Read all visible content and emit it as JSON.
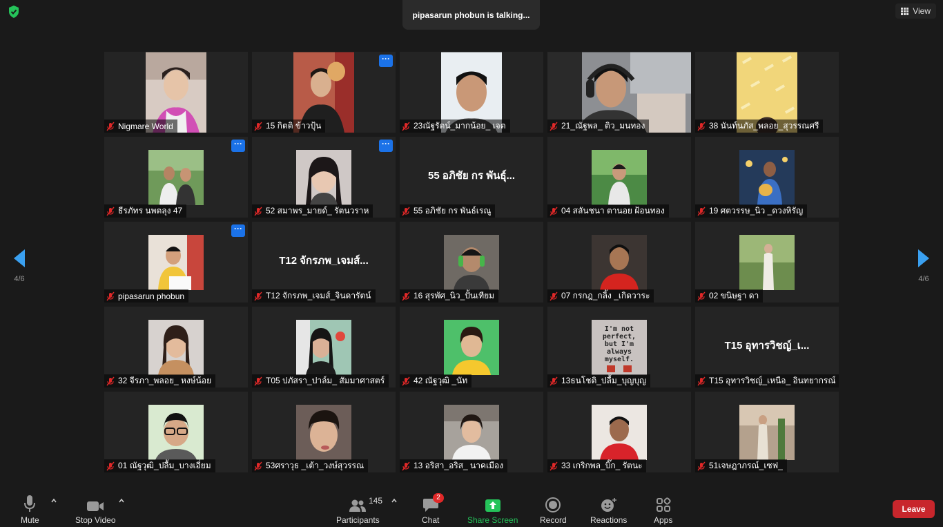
{
  "header": {
    "talking_banner": "pipasarun phobun is talking...",
    "view_label": "View"
  },
  "pager": {
    "left": "4/6",
    "right": "4/6"
  },
  "participants": [
    {
      "name": "Nigmare World",
      "video": true,
      "more_menu": false
    },
    {
      "name": "15 กิตติ ข้าวปุ้น",
      "video": true,
      "more_menu": true
    },
    {
      "name": "23ณัฐรัตน์_มากน้อย_ เจต",
      "video": true,
      "more_menu": false
    },
    {
      "name": "21_ณัฐพล_ ติว_มนทอง",
      "video": true,
      "more_menu": false
    },
    {
      "name": "38 นันท์นภัส_พลอย_สุวรรณศรี",
      "video": true,
      "more_menu": false
    },
    {
      "name": "ธีรภัทร นพตลุง 47",
      "video": true,
      "more_menu": true
    },
    {
      "name": "52 สมาพร_มายด์_ รัตนวราห",
      "video": true,
      "more_menu": true
    },
    {
      "name": "55 อภิชัย กร พันธ์เรณู",
      "big_label": "55 อภิชัย กร พันธุ์...",
      "video": false,
      "more_menu": false
    },
    {
      "name": "04 สลันชนา ตานอย ฝ้อนทอง",
      "video": true,
      "more_menu": false
    },
    {
      "name": "19 ศตวรรษ_นิว _ดวงหิรัญ",
      "video": true,
      "more_menu": false
    },
    {
      "name": "pipasarun phobun",
      "video": true,
      "more_menu": true
    },
    {
      "name": "T12 จักรภพ_เจมส์_จินดารัตน์",
      "big_label": "T12 จักรภพ_เจมส์...",
      "video": false,
      "more_menu": false
    },
    {
      "name": "16 สุรพัศ_นิว_ปั้นเทียม",
      "video": true,
      "more_menu": false
    },
    {
      "name": "07 กรกฎ_กลิ้ง _เกิดวาระ",
      "video": true,
      "more_menu": false
    },
    {
      "name": "02 ขนิษฐา ดา",
      "video": true,
      "more_menu": false
    },
    {
      "name": "32 จีรภา_พลอย_ หงษ์น้อย",
      "video": true,
      "more_menu": false
    },
    {
      "name": "T05 ปภัสรา_ปาล์ม_ สัมมาศาสตร์",
      "video": true,
      "more_menu": false
    },
    {
      "name": "42 ณัฐวุฒิ _นัท",
      "video": true,
      "more_menu": false
    },
    {
      "name": "13ธนโชติ_ปลื้ม_บุญบุญ",
      "video": true,
      "more_menu": false,
      "sign_text": "I'm not perfect, but I'm always myself."
    },
    {
      "name": "T15 อุทารวิชญ์_เหนือ_ อินทยากรณ์",
      "big_label": "T15 อุทารวิชญ์_เ...",
      "video": false,
      "more_menu": false
    },
    {
      "name": "01 ณัฐวุฒิ_ปลื้ม_บางเอี่ยม",
      "video": true,
      "more_menu": false
    },
    {
      "name": "53ศราวุธ _เต้า_วงษ์สุวรรณ",
      "video": true,
      "more_menu": false
    },
    {
      "name": "13 อริสา_อริส_ นาคเมือง",
      "video": true,
      "more_menu": false
    },
    {
      "name": "33 เกริกพล_บิ๊ก_ รัตนะ",
      "video": true,
      "more_menu": false
    },
    {
      "name": "51เจษฎาภรณ์_เซฟ_",
      "video": true,
      "more_menu": false
    }
  ],
  "toolbar": {
    "mute": "Mute",
    "stop_video": "Stop Video",
    "participants": "Participants",
    "participants_count": "145",
    "chat": "Chat",
    "chat_badge": "2",
    "share_screen": "Share Screen",
    "record": "Record",
    "reactions": "Reactions",
    "apps": "Apps",
    "leave": "Leave"
  },
  "colors": {
    "background": "#1a1a1a",
    "tile": "#242424",
    "accent_blue": "#1b72e8",
    "share_green": "#25c35a",
    "leave_red": "#c8262c",
    "muted_red": "#e02828",
    "shield_green": "#25c35a"
  }
}
